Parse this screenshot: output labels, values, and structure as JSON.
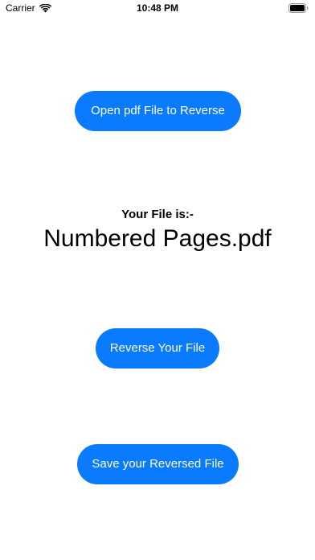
{
  "status_bar": {
    "carrier": "Carrier",
    "time": "10:48 PM",
    "icons": [
      "wifi-icon",
      "battery-icon"
    ]
  },
  "actions": {
    "open_label": "Open pdf File to Reverse",
    "reverse_label": "Reverse Your File",
    "save_label": "Save your Reversed File"
  },
  "file": {
    "label": "Your File is:-",
    "name": "Numbered Pages.pdf"
  },
  "colors": {
    "accent": "#0a7aff",
    "background": "#ffffff",
    "button_text": "#ffffff",
    "text": "#000000"
  }
}
